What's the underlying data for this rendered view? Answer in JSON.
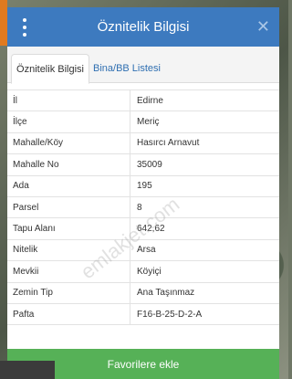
{
  "header": {
    "title": "Öznitelik Bilgisi",
    "close_icon": "close-icon",
    "menu_icon": "kebab-menu-icon"
  },
  "tabs": [
    {
      "label": "Öznitelik Bilgisi",
      "active": true
    },
    {
      "label": "Bina/BB Listesi",
      "active": false
    }
  ],
  "rows": [
    {
      "key": "İl",
      "value": "Edirne"
    },
    {
      "key": "İlçe",
      "value": "Meriç"
    },
    {
      "key": "Mahalle/Köy",
      "value": "Hasırcı Arnavut"
    },
    {
      "key": "Mahalle No",
      "value": "35009"
    },
    {
      "key": "Ada",
      "value": "195"
    },
    {
      "key": "Parsel",
      "value": "8"
    },
    {
      "key": "Tapu Alanı",
      "value": "642,62"
    },
    {
      "key": "Nitelik",
      "value": "Arsa"
    },
    {
      "key": "Mevkii",
      "value": "Köyiçi"
    },
    {
      "key": "Zemin Tip",
      "value": "Ana Taşınmaz"
    },
    {
      "key": "Pafta",
      "value": "F16-B-25-D-2-A"
    }
  ],
  "footer": {
    "button_label": "Favorilere ekle"
  },
  "watermark": "emlakjet.com",
  "colors": {
    "header": "#3d7abf",
    "button": "#56b157",
    "tab_link": "#2f6fb1"
  }
}
